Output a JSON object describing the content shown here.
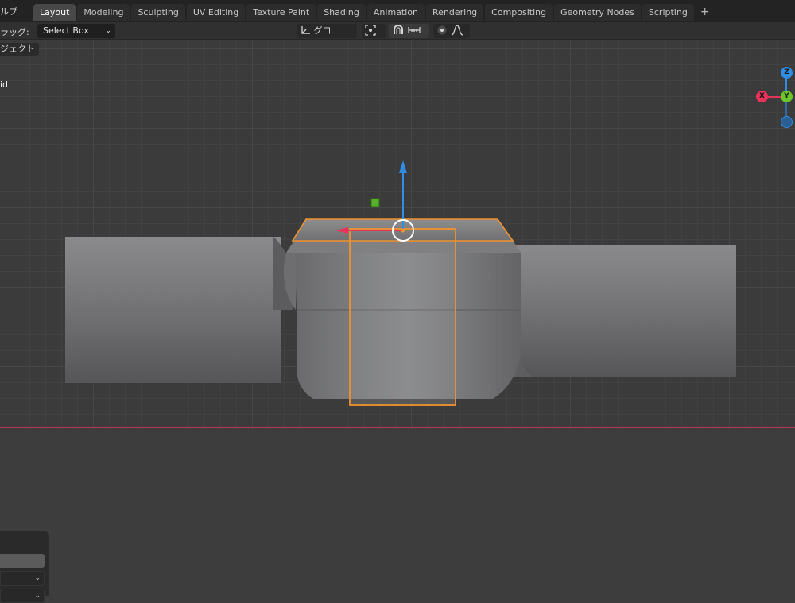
{
  "topbar": {
    "help_menu": "ルプ",
    "tabs": [
      {
        "label": "Layout",
        "active": true
      },
      {
        "label": "Modeling"
      },
      {
        "label": "Sculpting"
      },
      {
        "label": "UV Editing"
      },
      {
        "label": "Texture Paint"
      },
      {
        "label": "Shading"
      },
      {
        "label": "Animation"
      },
      {
        "label": "Rendering"
      },
      {
        "label": "Compositing"
      },
      {
        "label": "Geometry Nodes"
      },
      {
        "label": "Scripting"
      }
    ],
    "add_tab": "+"
  },
  "toolheader": {
    "drag_label": "ラッグ:",
    "select_mode": "Select Box",
    "transform_orientation": "グロー...",
    "pivot_icon": "pivot-point-icon",
    "snap_icon": "snap-magnet-icon",
    "snap_target_icon": "snap-increment-icon",
    "proportional_icon": "proportional-edit-icon",
    "falloff_icon": "falloff-curve-icon"
  },
  "viewport": {
    "object_mode_label": "ジェクト",
    "overlay_text": "id",
    "navigation_gizmo": {
      "x": "X",
      "y": "Y",
      "z": "Z"
    },
    "colors": {
      "selection_outline": "#f0922f",
      "x_axis": "#e8325a",
      "y_axis": "#6ac42a",
      "z_axis": "#2f8de4",
      "x_axis_floor_line": "#b33a4d"
    }
  }
}
